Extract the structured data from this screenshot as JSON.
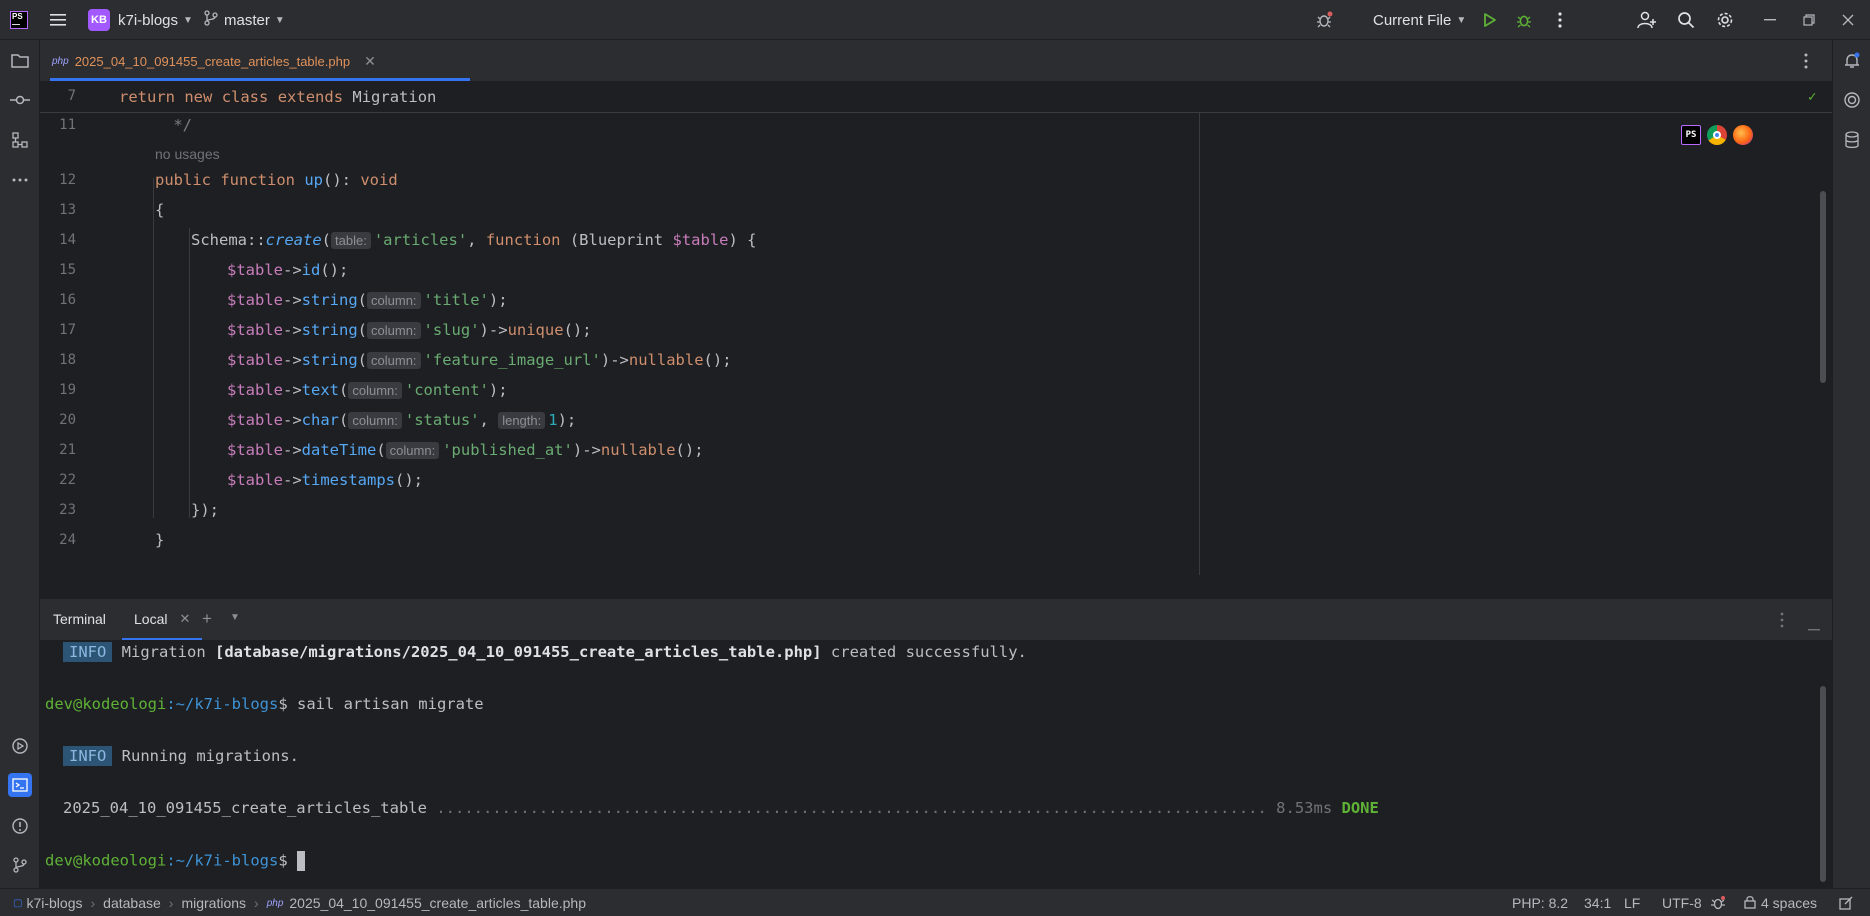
{
  "titlebar": {
    "project_initials": "KB",
    "project_name": "k7i-blogs",
    "branch": "master",
    "run_config": "Current File"
  },
  "editor": {
    "tab": {
      "lang": "php",
      "filename": "2025_04_10_091455_create_articles_table.php"
    },
    "sticky": {
      "line": "7",
      "kw1": "return",
      "kw2": "new",
      "kw3": "class",
      "kw4": "extends",
      "cls": "Migration"
    },
    "usages_hint": "no usages",
    "lines": {
      "n11": "11",
      "n12": "12",
      "n13": "13",
      "n14": "14",
      "n15": "15",
      "n16": "16",
      "n17": "17",
      "n18": "18",
      "n19": "19",
      "n20": "20",
      "n21": "21",
      "n22": "22",
      "n23": "23",
      "n24": "24"
    },
    "code": {
      "l11": " */",
      "l12_kw1": "public",
      "l12_kw2": "function",
      "l12_fn": "up",
      "l12_rest": "(): ",
      "l12_kw3": "void",
      "l13": "{",
      "l14_cls": "Schema",
      "l14_sep": "::",
      "l14_fn": "create",
      "l14_hint": "table:",
      "l14_str": "'articles'",
      "l14_kw": "function",
      "l14_type": "Blueprint",
      "l14_var": "$table",
      "var": "$table",
      "arrow": "->",
      "l15_fn": "id",
      "hint_column": "column:",
      "hint_length": "length:",
      "l16_fn": "string",
      "l16_str": "'title'",
      "l17_fn": "string",
      "l17_str": "'slug'",
      "l17_fn2": "unique",
      "l18_fn": "string",
      "l18_str": "'feature_image_url'",
      "l18_fn2": "nullable",
      "l19_fn": "text",
      "l19_str": "'content'",
      "l20_fn": "char",
      "l20_str": "'status'",
      "l20_num": "1",
      "l21_fn": "dateTime",
      "l21_str": "'published_at'",
      "l21_fn2": "nullable",
      "l22_fn": "timestamps",
      "l23": "});",
      "l24": "}"
    }
  },
  "terminal": {
    "title": "Terminal",
    "tab": "Local",
    "info_label": "INFO",
    "line1_pre": "Migration ",
    "line1_path": "[database/migrations/2025_04_10_091455_create_articles_table.php]",
    "line1_post": " created successfully.",
    "prompt_user": "dev@kodeologi",
    "prompt_path": ":~/k7i-blogs",
    "prompt_sign": "$ ",
    "command": "sail artisan migrate",
    "running": "Running migrations.",
    "migration_name": "2025_04_10_091455_create_articles_table",
    "dots": " ......................................................................................... ",
    "time": "8.53ms",
    "done": "DONE"
  },
  "statusbar": {
    "crumbs": [
      "k7i-blogs",
      "database",
      "migrations",
      "2025_04_10_091455_create_articles_table.php"
    ],
    "php_version": "PHP: 8.2",
    "position": "34:1",
    "line_ending": "LF",
    "encoding": "UTF-8",
    "indent": "4 spaces"
  }
}
